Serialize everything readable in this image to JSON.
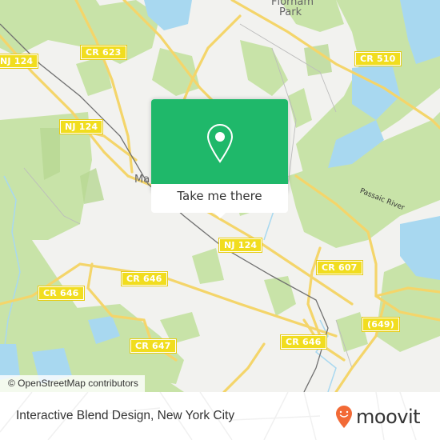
{
  "map": {
    "place_labels": {
      "florham_park_line1": "Florham",
      "florham_park_line2": "Park",
      "madison_partial": "Ma"
    },
    "river_label": "Passaic River",
    "road_shields": [
      {
        "id": "nj124_nw",
        "label": "NJ 124"
      },
      {
        "id": "cr623",
        "label": "CR 623"
      },
      {
        "id": "cr510",
        "label": "CR 510"
      },
      {
        "id": "nj124_w",
        "label": "NJ 124"
      },
      {
        "id": "nj124_c",
        "label": "NJ 124"
      },
      {
        "id": "cr607",
        "label": "CR 607"
      },
      {
        "id": "cr646_c",
        "label": "CR 646"
      },
      {
        "id": "cr646_w",
        "label": "CR 646"
      },
      {
        "id": "r649",
        "label": "(649)"
      },
      {
        "id": "cr647",
        "label": "CR 647"
      },
      {
        "id": "cr646_s",
        "label": "CR 646"
      }
    ],
    "attribution": "© OpenStreetMap contributors"
  },
  "popup": {
    "icon": "location-pin-icon",
    "action_label": "Take me there",
    "color": "#1fb86a"
  },
  "footer": {
    "title": "Interactive Blend Design, New York City",
    "brand": "moovit",
    "brand_color": "#f26a36"
  }
}
